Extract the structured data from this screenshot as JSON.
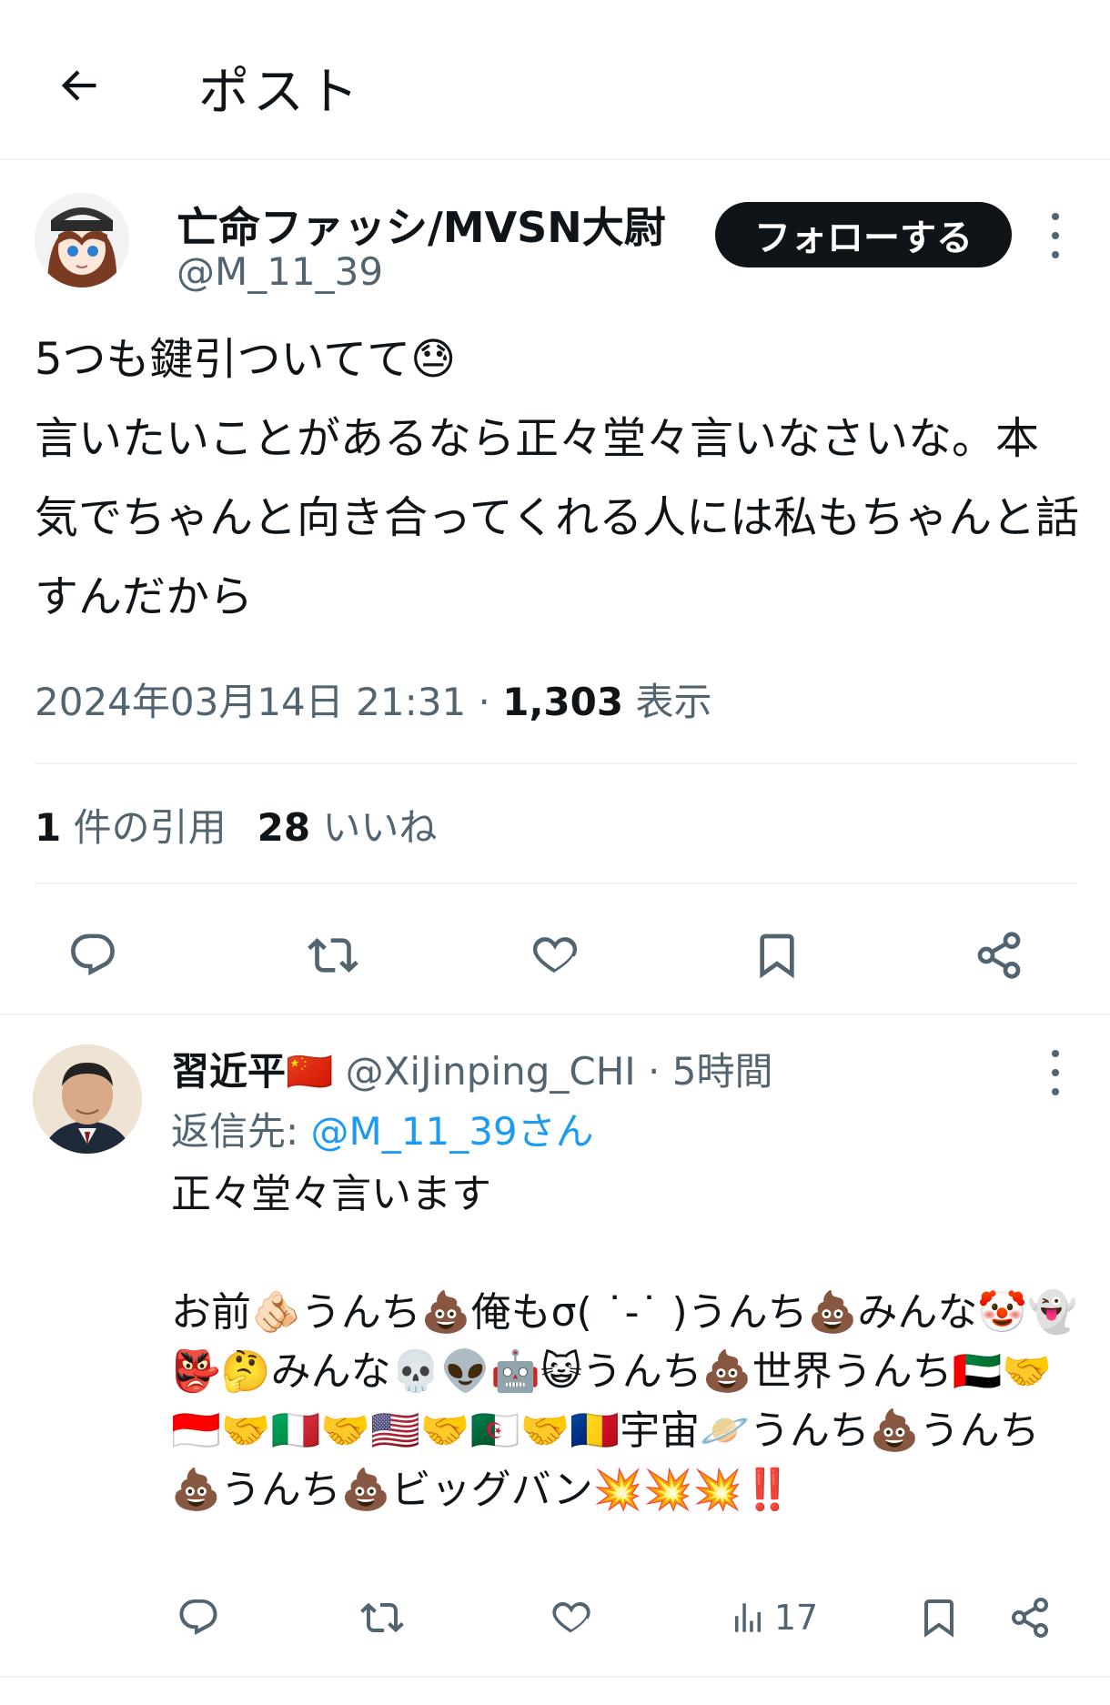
{
  "header": {
    "title": "ポスト"
  },
  "post": {
    "author_name": "亡命ファッシ/MVSN大尉",
    "author_handle": "@M_11_39",
    "follow_label": "フォローする",
    "text": "5つも鍵引ついてて😓\n言いたいことがあるなら正々堂々言いなさいな。本気でちゃんと向き合ってくれる人には私もちゃんと話すんだから",
    "timestamp": "2024年03月14日 21:31",
    "separator": " · ",
    "views_count": "1,303",
    "views_label": " 表示",
    "quotes_count": "1",
    "quotes_label": " 件の引用",
    "likes_count": "28",
    "likes_label": " いいね"
  },
  "reply": {
    "author_name": "習近平🇨🇳",
    "author_handle": " @XiJinping_CHI",
    "time": " · 5時間",
    "reply_to_prefix": "返信先: ",
    "reply_to_handle": "@M_11_39さん",
    "text": "正々堂々言います\n\nお前🫵🏻うんち💩俺もσ( ˙-˙ )うんち💩みんな🤡👻👺🤔みんな💀👽🤖😺うんち💩世界うんち🇦🇪🤝🇮🇩🤝🇮🇹🤝🇺🇸🤝🇩🇿🤝🇷🇴宇宙🪐うんち💩うんち💩うんち💩ビッグバン💥💥💥‼️",
    "views_count": "17"
  },
  "colors": {
    "text": "#0f1419",
    "secondary": "#536471",
    "link": "#1d9bf0",
    "divider": "#eff3f4"
  },
  "icons": [
    "back-arrow-icon",
    "more-icon",
    "reply-icon",
    "retweet-icon",
    "like-icon",
    "bookmark-icon",
    "share-icon",
    "views-icon"
  ]
}
